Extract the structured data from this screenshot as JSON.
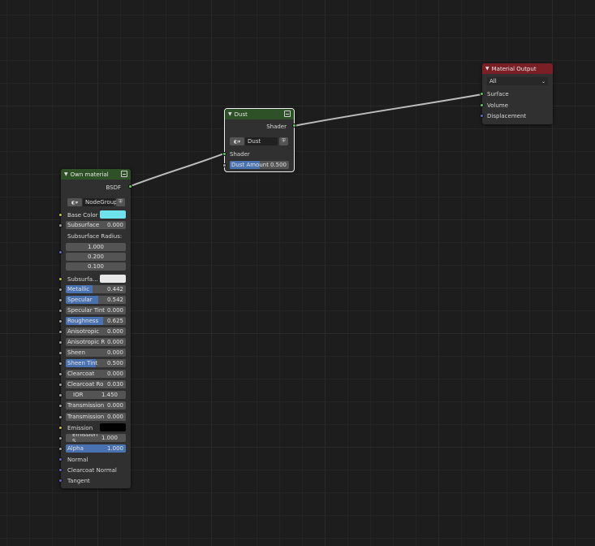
{
  "colors": {
    "base_color": "#6ee3ec",
    "subsurface_color": "#e8e8e8",
    "emission_color": "#000000"
  },
  "nodes": {
    "own_material": {
      "title": "Own material",
      "output": "BSDF",
      "group": "NodeGroup",
      "base_color": "Base Color",
      "subsurface": {
        "label": "Subsurface",
        "value": "0.000"
      },
      "subsurface_radius": {
        "label": "Subsurface Radius:",
        "values": [
          "1.000",
          "0.200",
          "0.100"
        ]
      },
      "subsurface_color": "Subsurfa...",
      "metallic": {
        "label": "Metallic",
        "value": "0.442",
        "fill": 0.442
      },
      "specular": {
        "label": "Specular",
        "value": "0.542",
        "fill": 0.542
      },
      "specular_tint": {
        "label": "Specular Tint",
        "value": "0.000"
      },
      "roughness": {
        "label": "Roughness",
        "value": "0.625",
        "fill": 0.625
      },
      "anisotropic": {
        "label": "Anisotropic",
        "value": "0.000"
      },
      "anisotropic_rot": {
        "label": "Anisotropic R",
        "value": "0.000"
      },
      "sheen": {
        "label": "Sheen",
        "value": "0.000"
      },
      "sheen_tint": {
        "label": "Sheen Tint",
        "value": "0.500",
        "fill": 0.5
      },
      "clearcoat": {
        "label": "Clearcoat",
        "value": "0.000"
      },
      "clearcoat_rough": {
        "label": "Clearcoat Ro",
        "value": "0.030"
      },
      "ior": {
        "label": "IOR",
        "value": "1.450"
      },
      "transmission": {
        "label": "Transmission",
        "value": "0.000"
      },
      "transmission_rough": {
        "label": "Transmission",
        "value": "0.000"
      },
      "emission": "Emission",
      "emission_strength": {
        "label": "Emission S",
        "value": "1.000"
      },
      "alpha": {
        "label": "Alpha",
        "value": "1.000",
        "fill": 1.0
      },
      "normal": "Normal",
      "clearcoat_normal": "Clearcoat Normal",
      "tangent": "Tangent"
    },
    "dust": {
      "title": "Dust",
      "output": "Shader",
      "group": "Dust",
      "input": "Shader",
      "dust_amount": {
        "label": "Dust Amount",
        "value": "0.500",
        "fill": 0.5
      }
    },
    "material_output": {
      "title": "Material Output",
      "target": "All",
      "inputs": [
        "Surface",
        "Volume",
        "Displacement"
      ]
    }
  }
}
